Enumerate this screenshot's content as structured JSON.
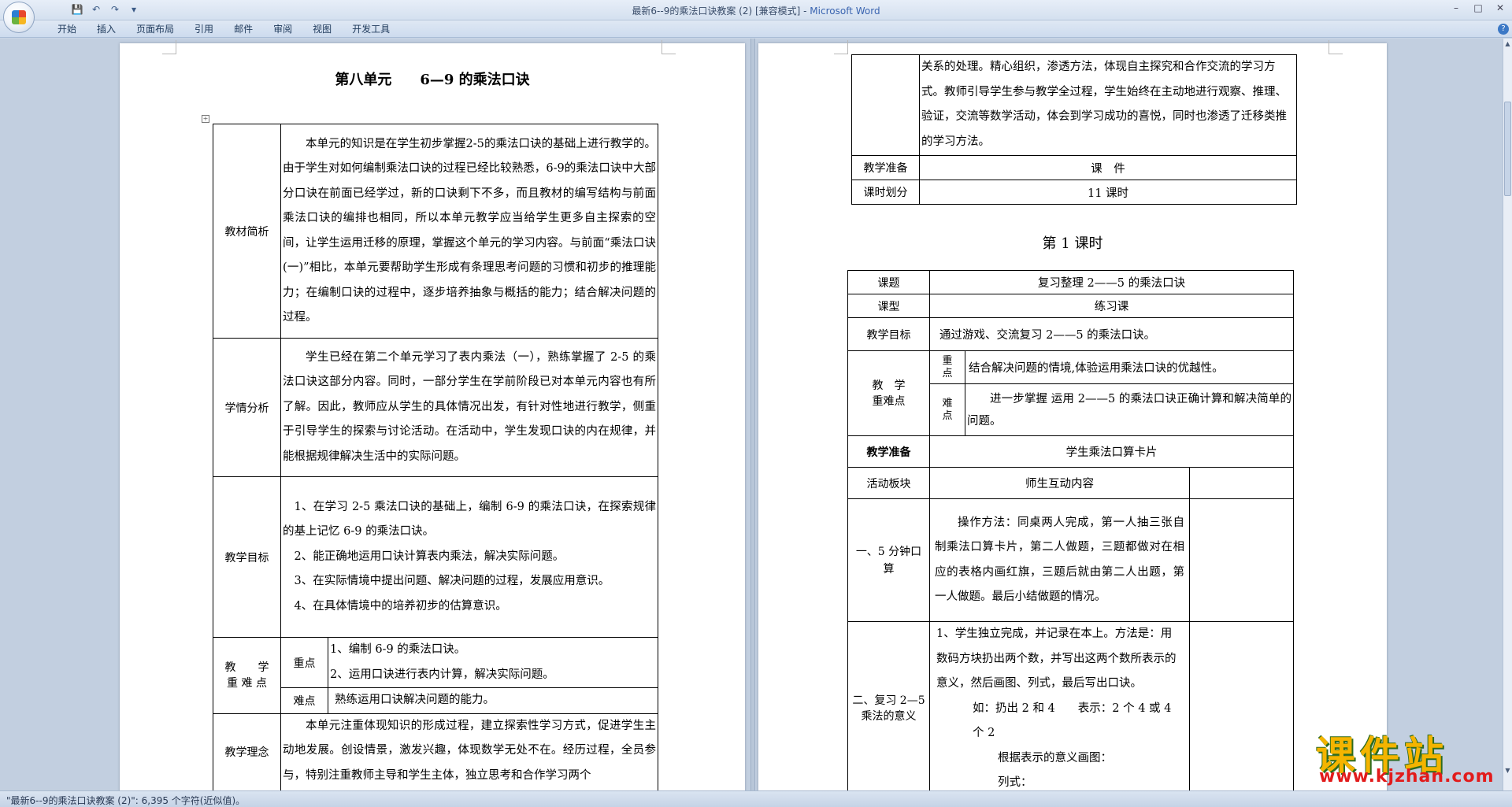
{
  "window": {
    "title": "最新6--9的乘法口诀教案 (2) [兼容模式]",
    "app_sep": " - ",
    "app_name": "Microsoft Word"
  },
  "quick_access": {
    "save_icon": "💾",
    "undo_icon": "↶",
    "redo_icon": "↷",
    "more_icon": "▾"
  },
  "ribbon": {
    "tabs": [
      "开始",
      "插入",
      "页面布局",
      "引用",
      "邮件",
      "审阅",
      "视图",
      "开发工具"
    ]
  },
  "left_page": {
    "title": "第八单元　　6—9 的乘法口诀",
    "rows": {
      "textbook_label": "教材简析",
      "textbook_text": "本单元的知识是在学生初步掌握2-5的乘法口诀的基础上进行教学的。由于学生对如何编制乘法口诀的过程已经比较熟悉，6-9的乘法口诀中大部分口诀在前面已经学过，新的口诀剩下不多，而且教材的编写结构与前面乘法口诀的编排也相同，所以本单元教学应当给学生更多自主探索的空间，让学生运用迁移的原理，掌握这个单元的学习内容。与前面“乘法口诀(一)”相比，本单元要帮助学生形成有条理思考问题的习惯和初步的推理能力；在编制口诀的过程中，逐步培养抽象与概括的能力；结合解决问题的过程。",
      "student_label": "学情分析",
      "student_text": "学生已经在第二个单元学习了表内乘法（一），熟练掌握了 2-5 的乘法口诀这部分内容。同时，一部分学生在学前阶段已对本单元内容也有所了解。因此，教师应从学生的具体情况出发，有针对性地进行教学，侧重于引导学生的探索与讨论活动。在活动中，学生发现口诀的内在规律，并能根据规律解决生活中的实际问题。",
      "goal_label": "教学目标",
      "goal_1": "1、在学习 2-5 乘法口诀的基础上，编制 6-9 的乘法口诀，在探索规律的基上记忆 6-9 的乘法口诀。",
      "goal_2": "2、能正确地运用口诀计算表内乘法，解决实际问题。",
      "goal_3": "3、在实际情境中提出问题、解决问题的过程，发展应用意识。",
      "goal_4": "4、在具体情境中的培养初步的估算意识。",
      "keypoint_label": "教　　学\n重 难 点",
      "key_label": "重点",
      "key_1": "1、编制 6-9 的乘法口诀。",
      "key_2": "2、运用口诀进行表内计算，解决实际问题。",
      "diff_label": "难点",
      "diff_text": "熟练运用口诀解决问题的能力。",
      "idea_label": "教学理念",
      "idea_text": "本单元注重体现知识的形成过程，建立探索性学习方式，促进学生主动地发展。创设情景，激发兴趣，体现数学无处不在。经历过程，全员参与，特别注重教师主导和学生主体，独立思考和合作学习两个"
    }
  },
  "right_page": {
    "top_text": "关系的处理。精心组织，渗透方法，体现自主探究和合作交流的学习方式。教师引导学生参与教学全过程，学生始终在主动地进行观察、推理、验证，交流等数学活动，体会到学习成功的喜悦，同时也渗透了迁移类推的学习方法。",
    "prep_label": "教学准备",
    "prep_value": "课　件",
    "hours_label": "课时划分",
    "hours_value": "11 课时",
    "lesson_title": "第 1 课时",
    "lesson": {
      "topic_label": "课题",
      "topic_value": "复习整理 2——5 的乘法口诀",
      "type_label": "课型",
      "type_value": "练习课",
      "goal_label": "教学目标",
      "goal_value": "通过游戏、交流复习 2——5 的乘法口诀。",
      "kd_label": "教　学\n重难点",
      "key_label": "重\n点",
      "key_value": "结合解决问题的情境,体验运用乘法口诀的优越性。",
      "diff_label": "难\n点",
      "diff_value": "进一步掌握  运用 2——5 的乘法口诀正确计算和解决简单的问题。",
      "prep_label": "教学准备",
      "prep_value": "学生乘法口算卡片",
      "block_label": "活动板块",
      "interact_label": "师生互动内容",
      "act1_label": "一、5 分钟口算",
      "act1_text": "操作方法：同桌两人完成，第一人抽三张自制乘法口算卡片，第二人做题，三题都做对在相应的表格内画红旗，三题后就由第二人出题，第一人做题。最后小结做题的情况。",
      "act2_label": "二、复习 2—5乘法的意义",
      "act2_text1": "1、学生独立完成，并记录在本上。方法是：用数码方块扔出两个数，并写出这两个数所表示的意义，然后画图、列式，最后写出口诀。",
      "act2_text2": "如：扔出 2 和 4　　表示：2 个 4 或 4 个 2",
      "act2_text3": "根据表示的意义画图：",
      "act2_text4": "列式："
    }
  },
  "status_bar": {
    "text": "\"最新6--9的乘法口诀教案 (2)\": 6,395 个字符(近似值)。"
  },
  "watermark": {
    "brand": "课件站",
    "url": "www.kjzhan.com"
  },
  "colors": {
    "title_bar": "#dae4f1",
    "workspace": "#c2cfe0",
    "watermark_brand": "#f4b400",
    "watermark_url": "#e21b1b"
  }
}
